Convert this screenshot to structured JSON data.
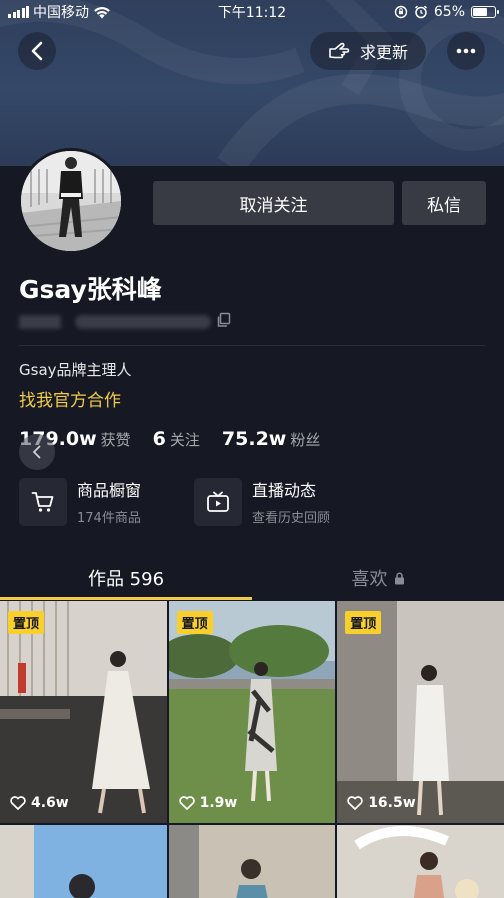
{
  "status_bar": {
    "carrier": "中国移动",
    "time": "下午11:12",
    "battery": "65%",
    "battery_level": 0.65
  },
  "header": {
    "back_icon": "back-arrow-icon",
    "update_label": "求更新",
    "more_icon": "more-dots-icon"
  },
  "profile": {
    "unfollow_label": "取消关注",
    "message_label": "私信",
    "username": "Gsay张科峰",
    "bio": "Gsay品牌主理人",
    "cooperation": "找我官方合作"
  },
  "stats": [
    {
      "value": "179.0w",
      "label": "获赞"
    },
    {
      "value": "6",
      "label": "关注"
    },
    {
      "value": "75.2w",
      "label": "粉丝"
    }
  ],
  "features": {
    "shop_title": "商品橱窗",
    "shop_sub": "174件商品",
    "live_title": "直播动态",
    "live_sub": "查看历史回顾"
  },
  "tabs": {
    "works": "作品 596",
    "likes": "喜欢"
  },
  "videos": [
    {
      "pinned": "置顶",
      "likes": "4.6w"
    },
    {
      "pinned": "置顶",
      "likes": "1.9w"
    },
    {
      "pinned": "置顶",
      "likes": "16.5w"
    }
  ],
  "colors": {
    "background": "#161823",
    "accent_yellow": "#f2cc46",
    "button_gray": "#393b44"
  }
}
